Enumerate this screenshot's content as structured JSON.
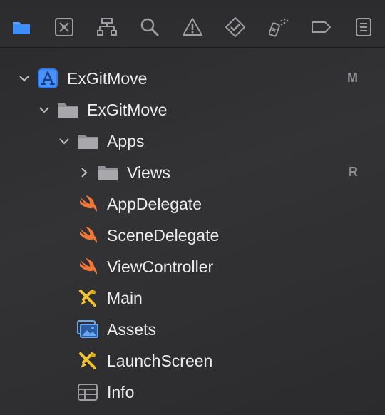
{
  "toolbar": {
    "icons": [
      {
        "name": "project-navigator-icon",
        "active": true
      },
      {
        "name": "source-control-icon"
      },
      {
        "name": "symbol-navigator-icon"
      },
      {
        "name": "find-icon"
      },
      {
        "name": "issue-icon"
      },
      {
        "name": "test-icon"
      },
      {
        "name": "debug-icon"
      },
      {
        "name": "breakpoint-icon"
      },
      {
        "name": "report-icon"
      }
    ],
    "accent_color": "#3d8ef7",
    "icon_color": "#9c9ca1"
  },
  "tree": {
    "project": {
      "label": "ExGitMove",
      "badge": "M"
    },
    "group": {
      "label": "ExGitMove"
    },
    "apps": {
      "label": "Apps"
    },
    "views": {
      "label": "Views",
      "badge": "R"
    },
    "files": [
      {
        "label": "AppDelegate",
        "kind": "swift"
      },
      {
        "label": "SceneDelegate",
        "kind": "swift"
      },
      {
        "label": "ViewController",
        "kind": "swift"
      },
      {
        "label": "Main",
        "kind": "storyboard"
      },
      {
        "label": "Assets",
        "kind": "assets"
      },
      {
        "label": "LaunchScreen",
        "kind": "storyboard"
      },
      {
        "label": "Info",
        "kind": "plist"
      }
    ]
  }
}
